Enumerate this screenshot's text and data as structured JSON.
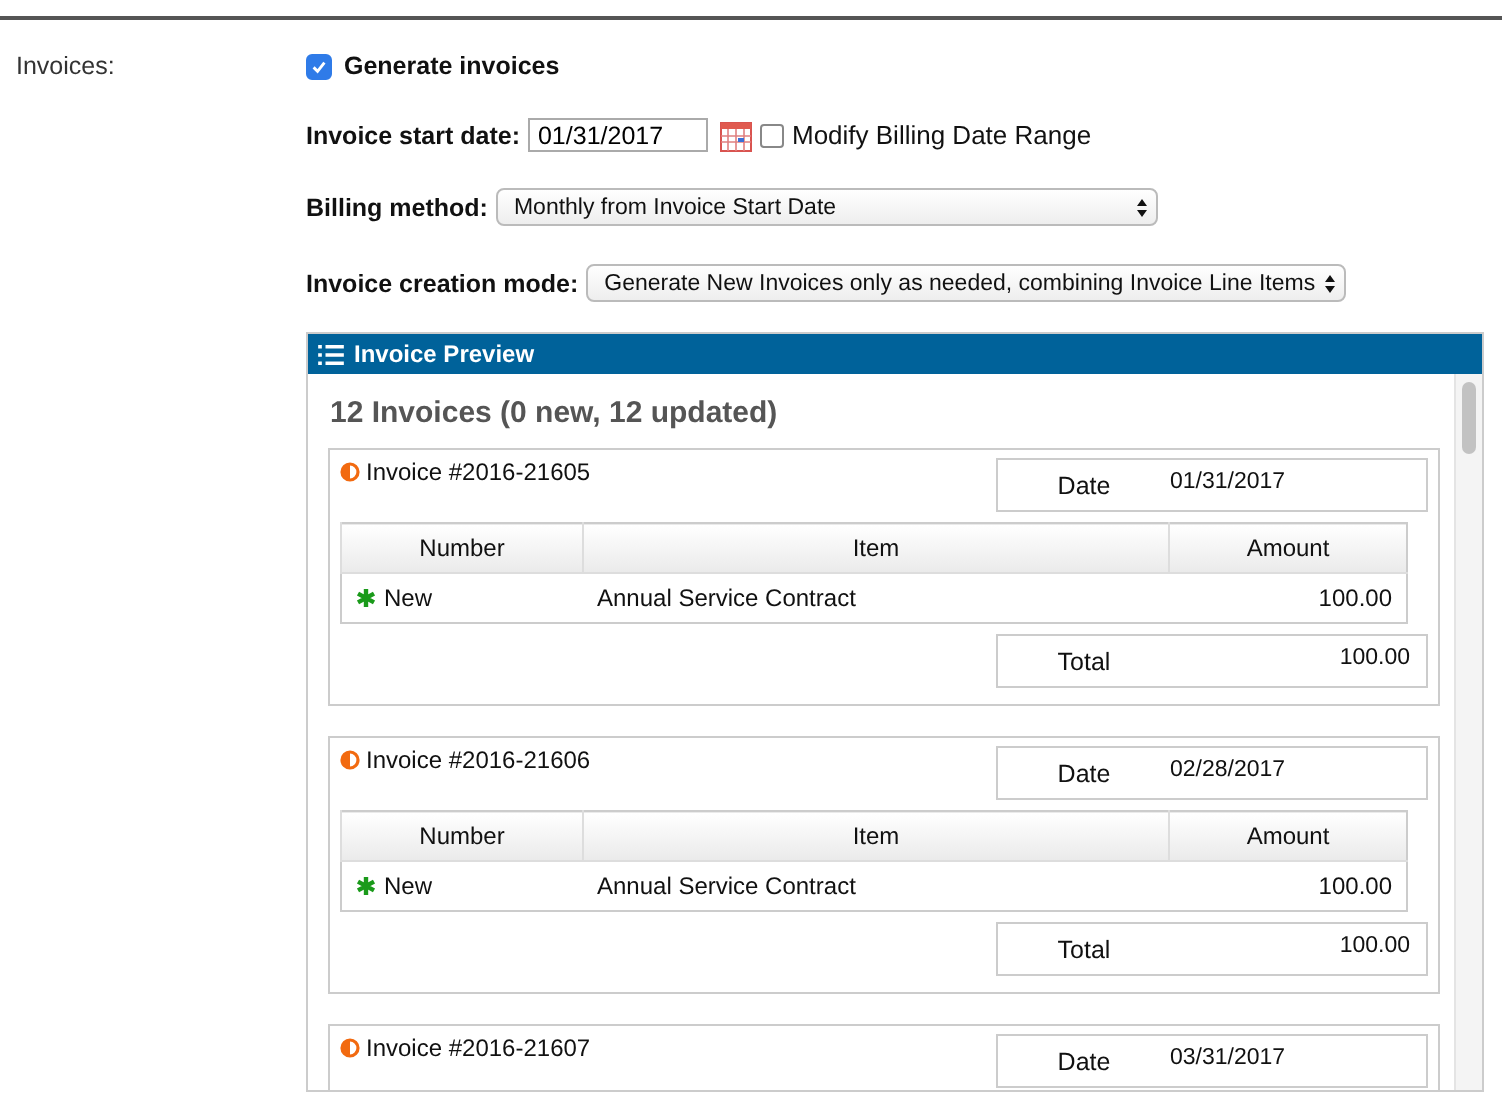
{
  "field_label": "Invoices:",
  "generate_invoices": {
    "label": "Generate invoices",
    "checked": true
  },
  "start_date": {
    "label": "Invoice start date:",
    "value": "01/31/2017"
  },
  "modify_range": {
    "label": "Modify Billing Date Range",
    "checked": false
  },
  "billing_method": {
    "label": "Billing method:",
    "value": "Monthly from Invoice Start Date"
  },
  "creation_mode": {
    "label": "Invoice creation mode:",
    "value": "Generate New Invoices only as needed, combining Invoice Line Items"
  },
  "preview": {
    "title": "Invoice Preview",
    "summary": "12 Invoices (0 new, 12 updated)",
    "invoices": [
      {
        "number": "Invoice #2016-21605",
        "date_label": "Date",
        "date": "01/31/2017",
        "columns": [
          "Number",
          "Item",
          "Amount"
        ],
        "lines": [
          {
            "number": "New",
            "item": "Annual Service Contract",
            "amount": "100.00"
          }
        ],
        "total_label": "Total",
        "total": "100.00"
      },
      {
        "number": "Invoice #2016-21606",
        "date_label": "Date",
        "date": "02/28/2017",
        "columns": [
          "Number",
          "Item",
          "Amount"
        ],
        "lines": [
          {
            "number": "New",
            "item": "Annual Service Contract",
            "amount": "100.00"
          }
        ],
        "total_label": "Total",
        "total": "100.00"
      },
      {
        "number": "Invoice #2016-21607",
        "date_label": "Date",
        "date": "03/31/2017"
      }
    ]
  }
}
